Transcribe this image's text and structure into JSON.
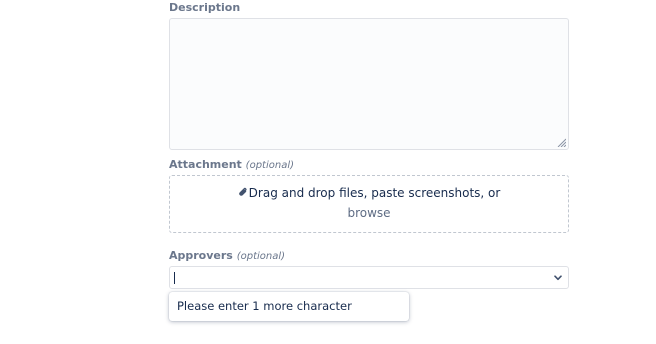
{
  "description": {
    "label": "Description",
    "value": ""
  },
  "attachment": {
    "label": "Attachment",
    "optional_text": "(optional)",
    "dropzone_text": "Drag and drop files, paste screenshots, or",
    "browse_label": "browse",
    "icon": "paperclip-icon"
  },
  "approvers": {
    "label": "Approvers",
    "optional_text": "(optional)",
    "value": "",
    "dropdown_message": "Please enter 1 more character",
    "icon": "chevron-down-icon"
  },
  "colors": {
    "label": "#6b778c",
    "text": "#172b4d",
    "border": "#dfe1e6",
    "link": "#5e6c84"
  }
}
